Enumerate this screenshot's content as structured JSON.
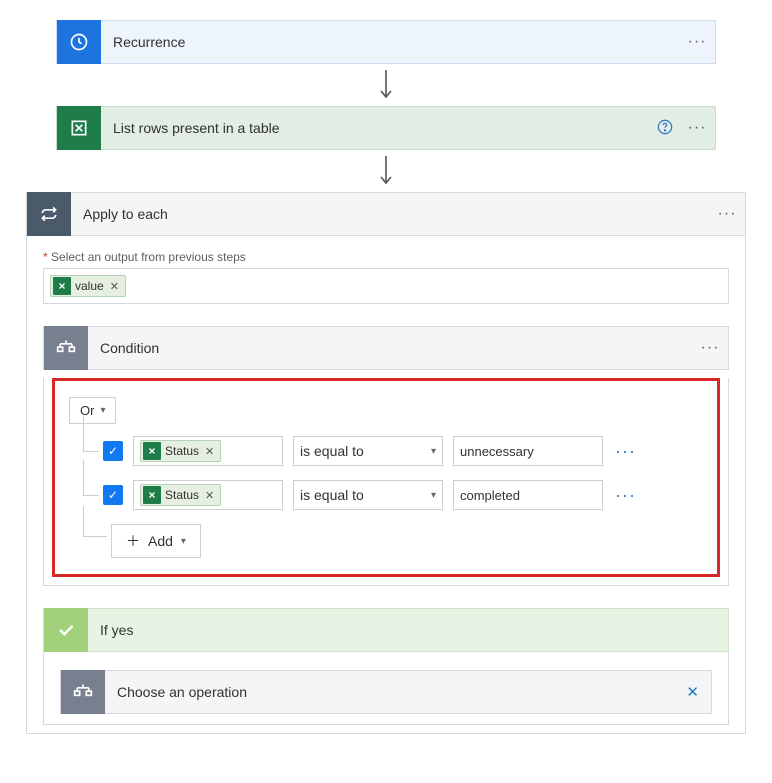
{
  "recurrence": {
    "title": "Recurrence"
  },
  "excel": {
    "title": "List rows present in a table"
  },
  "apply": {
    "title": "Apply to each",
    "req_label": "Select an output from previous steps",
    "output_pill": "value"
  },
  "condition": {
    "title": "Condition",
    "logic": "Or",
    "rows": [
      {
        "left_pill": "Status",
        "op": "is equal to",
        "val": "unnecessary"
      },
      {
        "left_pill": "Status",
        "op": "is equal to",
        "val": "completed"
      }
    ],
    "add_label": "Add"
  },
  "ifyes": {
    "title": "If yes",
    "choose": "Choose an operation"
  }
}
